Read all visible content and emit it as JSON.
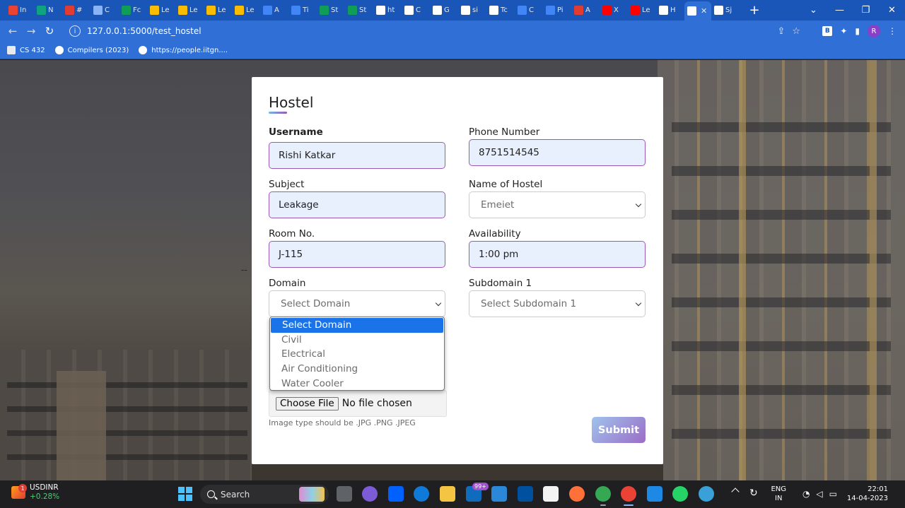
{
  "browser": {
    "tabs": [
      {
        "label": "In",
        "color": "#ea4335"
      },
      {
        "label": "N",
        "color": "#10a37f"
      },
      {
        "label": "#",
        "color": "#e03c31"
      },
      {
        "label": "C",
        "color": "#8ab4f8"
      },
      {
        "label": "Fc",
        "color": "#0f9d58"
      },
      {
        "label": "Le",
        "color": "#fbbc04"
      },
      {
        "label": "Le",
        "color": "#fbbc04"
      },
      {
        "label": "Le",
        "color": "#fbbc04"
      },
      {
        "label": "Le",
        "color": "#fbbc04"
      },
      {
        "label": "A",
        "color": "#4285f4"
      },
      {
        "label": "Ti",
        "color": "#4285f4"
      },
      {
        "label": "St",
        "color": "#0f9d58"
      },
      {
        "label": "St",
        "color": "#0f9d58"
      },
      {
        "label": "ht",
        "color": "#ffffff"
      },
      {
        "label": "C",
        "color": "#ffffff"
      },
      {
        "label": "G",
        "color": "#ffffff"
      },
      {
        "label": "si",
        "color": "#ffffff"
      },
      {
        "label": "Tc",
        "color": "#ffffff"
      },
      {
        "label": "C",
        "color": "#4285f4"
      },
      {
        "label": "Pi",
        "color": "#4285f4"
      },
      {
        "label": "A",
        "color": "#e03c31"
      },
      {
        "label": "X",
        "color": "#ff0000"
      },
      {
        "label": "Le",
        "color": "#ff0000"
      },
      {
        "label": "H",
        "color": "#ffffff"
      },
      {
        "label": "",
        "color": "#ffffff",
        "active": true
      },
      {
        "label": "Sj",
        "color": "#ffffff"
      }
    ],
    "url": "127.0.0.1:5000/test_hostel",
    "profile_initial": "R",
    "bookmarks": [
      "CS 432",
      "Compilers (2023)",
      "https://people.iitgn...."
    ]
  },
  "form": {
    "title": "Hostel",
    "username_label": "Username",
    "username_value": "Rishi Katkar",
    "phone_label": "Phone Number",
    "phone_value": "8751514545",
    "subject_label": "Subject",
    "subject_value": "Leakage",
    "hostel_label": "Name of Hostel",
    "hostel_value": "Emeiet",
    "room_label": "Room No.",
    "room_value": "J-115",
    "availability_label": "Availability",
    "availability_value": "1:00 pm",
    "domain_label": "Domain",
    "domain_value": "Select Domain",
    "subdomain_label": "Subdomain 1",
    "subdomain_value": "Select Subdomain 1",
    "domain_options": [
      "Select Domain",
      "Civil",
      "Electrical",
      "Air Conditioning",
      "Water Cooler"
    ],
    "domain_selected_index": 0,
    "choose_file_label": "Choose File",
    "file_status": "No file chosen",
    "file_hint": "Image type should be .JPG .PNG .JPEG",
    "submit_label": "Submit",
    "stray_mark": "--"
  },
  "taskbar": {
    "ticker_name": "USDINR",
    "ticker_change": "+0.28%",
    "ticker_badge": "1",
    "search_label": "Search",
    "mail_badge": "99+",
    "language": [
      "ENG",
      "IN"
    ],
    "time": "22:01",
    "date": "14-04-2023"
  }
}
